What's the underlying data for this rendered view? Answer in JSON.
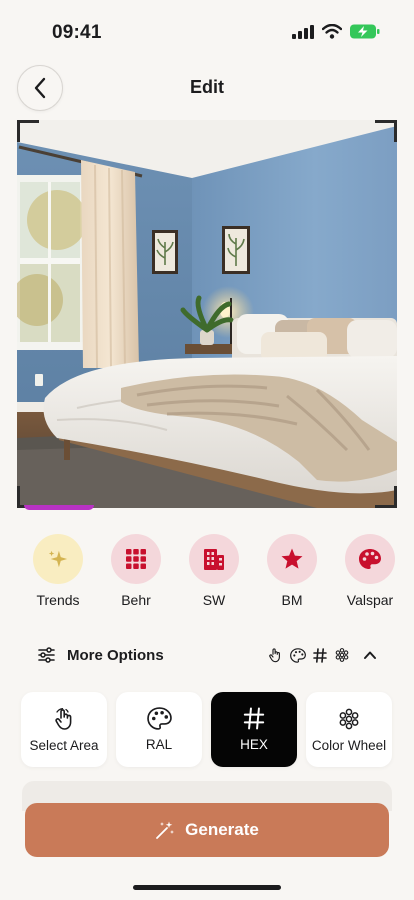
{
  "status_bar": {
    "time": "09:41"
  },
  "header": {
    "title": "Edit"
  },
  "brands": [
    {
      "label": "Trends",
      "icon": "sparkle-icon"
    },
    {
      "label": "Behr",
      "icon": "grid-icon"
    },
    {
      "label": "SW",
      "icon": "building-icon"
    },
    {
      "label": "BM",
      "icon": "star-icon"
    },
    {
      "label": "Valspar",
      "icon": "palette-icon"
    }
  ],
  "more_options": {
    "label": "More Options"
  },
  "methods": [
    {
      "label": "Select Area",
      "icon": "hand-pointer-icon",
      "selected": false
    },
    {
      "label": "RAL",
      "icon": "palette-icon",
      "selected": false
    },
    {
      "label": "HEX",
      "icon": "hash-icon",
      "selected": true
    },
    {
      "label": "Color Wheel",
      "icon": "color-wheel-icon",
      "selected": false
    }
  ],
  "generate": {
    "label": "Generate"
  },
  "colors": {
    "accent": "#c97a58",
    "brand_circle": "#f4d7db",
    "brand_icon": "#c8102e",
    "trends_circle": "#f9edc1",
    "wall": "#7fa3c6"
  }
}
